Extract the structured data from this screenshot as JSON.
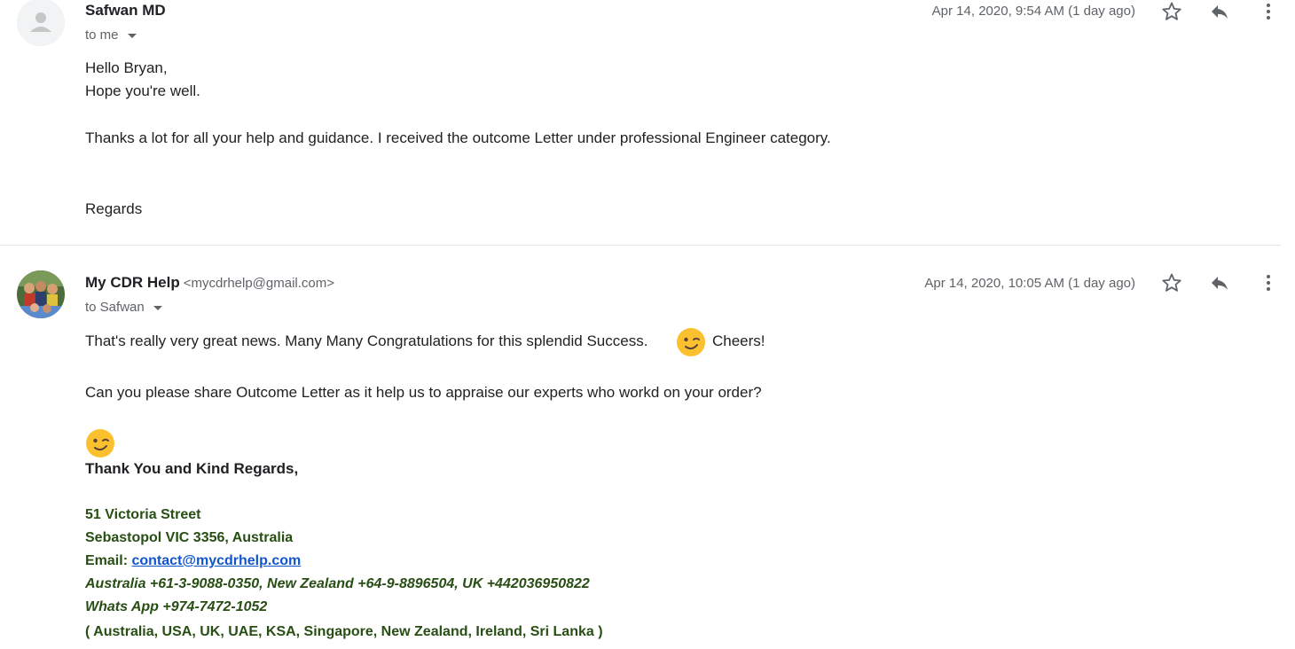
{
  "messages": [
    {
      "sender_name": "Safwan MD",
      "sender_email": "",
      "recipient": "to me",
      "date": "Apr 14, 2020, 9:54 AM (1 day ago)",
      "body": [
        "Hello Bryan,",
        "Hope you're well.",
        "Thanks a lot for all your help and guidance. I received the outcome Letter under professional Engineer category.",
        "Regards"
      ]
    },
    {
      "sender_name": "My CDR Help",
      "sender_email": "<mycdrhelp@gmail.com>",
      "recipient": "to Safwan",
      "date": "Apr 14, 2020, 10:05 AM (1 day ago)",
      "body": [
        "That's really very great news. Many Many Congratulations for this splendid Success.",
        "Cheers!",
        "Can you please share Outcome Letter as it help us to appraise our experts who workd on your order?"
      ],
      "signature": {
        "closing": "Thank You and Kind Regards,",
        "street": "51 Victoria Street",
        "city": "Sebastopol VIC 3356, Australia",
        "email_label": "Email:",
        "email": "contact@mycdrhelp.com",
        "phones": "Australia +61-3-9088-0350, New Zealand +64-9-8896504, UK +442036950822",
        "whatsapp": "Whats App +974-7472-1052",
        "countries": "( Australia, USA, UK, UAE, KSA, Singapore, New Zealand, Ireland, Sri Lanka )"
      }
    }
  ],
  "icons": [
    "person-placeholder-icon",
    "star-icon",
    "reply-icon",
    "more-vertical-icon",
    "wink-emoji-icon"
  ],
  "colors": {
    "signature_green": "#274e13",
    "link_blue": "#1155cc",
    "meta_gray": "#5f6368",
    "emoji_yellow": "#fbc02d"
  }
}
